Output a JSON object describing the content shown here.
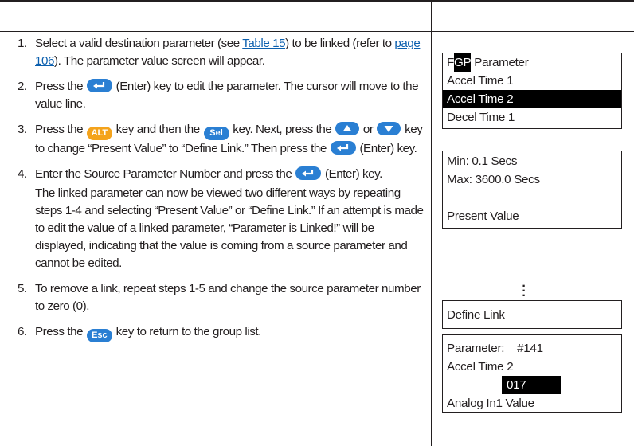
{
  "steps": [
    {
      "num": "1.",
      "pre": "Select a valid destination parameter (see ",
      "link1": "Table 15",
      "mid": ") to be linked (refer to ",
      "link2": "page 106",
      "post": "). The parameter value screen will appear."
    },
    {
      "num": "2.",
      "pre": "Press the ",
      "key": "enter",
      "post": " (Enter) key to edit the parameter. The cursor will move to the value line."
    },
    {
      "num": "3.",
      "pre": "Press the ",
      "key1": "ALT",
      "mid1": " key and then the ",
      "key2": "Sel",
      "mid2": " key. Next, press the ",
      "mid3": " or ",
      "mid4": " key to change “Present Value” to “Define Link.” Then press the ",
      "post": " (Enter) key."
    },
    {
      "num": "4.",
      "pre": "Enter the Source Parameter Number and press the ",
      "post": " (Enter) key.",
      "note": "The linked parameter can now be viewed two different ways by repeating steps 1-4 and selecting “Present Value” or “Define Link.” If an attempt is made to edit the value of a linked parameter, “Parameter is Linked!” will be displayed, indicating that the value is coming from a source parameter and cannot be edited."
    },
    {
      "num": "5.",
      "text": "To remove a link, repeat steps 1-5 and change the source parameter number to zero (0)."
    },
    {
      "num": "6.",
      "pre": "Press the ",
      "key": "Esc",
      "post": " key to return to the group list."
    }
  ],
  "panel1": {
    "title_prefix": "F",
    "title_cursor": "G",
    "title_cursor2": "P",
    "title_suffix": " Parameter",
    "lines": [
      "Accel Time 1",
      "Accel Time 2",
      "Decel Time 1"
    ]
  },
  "panel2": {
    "lines": [
      "Min: 0.1 Secs",
      "Max: 3600.0 Secs",
      "",
      "Present Value"
    ]
  },
  "panel3": {
    "lines": [
      "Define Link"
    ]
  },
  "panel4": {
    "param_label": "Parameter:",
    "param_num": "#141",
    "name": "Accel Time 2",
    "value": "017",
    "source": "Analog In1 Value"
  },
  "colors": {
    "key_blue": "#2a7fd3",
    "key_orange": "#f4a31c",
    "link": "#0b5fae"
  }
}
